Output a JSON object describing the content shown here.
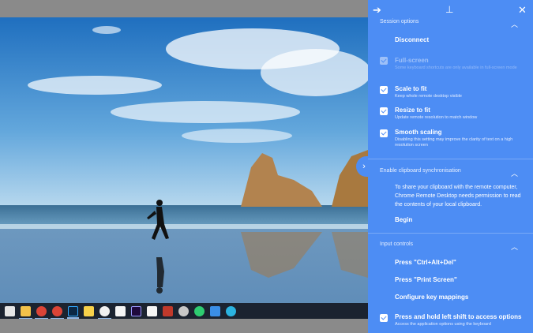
{
  "panel": {
    "top_icons": {
      "forward": "arrow-right-icon",
      "pin": "pin-icon",
      "close": "close-icon"
    },
    "sections": {
      "session": {
        "title": "Session options",
        "disconnect": "Disconnect",
        "options": [
          {
            "label": "Full-screen",
            "desc": "Some keyboard shortcuts are only available in full-screen mode",
            "checked": true,
            "disabled": true
          },
          {
            "label": "Scale to fit",
            "desc": "Keep whole remote desktop visible",
            "checked": true,
            "disabled": false
          },
          {
            "label": "Resize to fit",
            "desc": "Update remote resolution to match window",
            "checked": true,
            "disabled": false
          },
          {
            "label": "Smooth scaling",
            "desc": "Disabling this setting may improve the clarity of text on a high resolution screen",
            "checked": true,
            "disabled": false
          }
        ]
      },
      "clipboard": {
        "title": "Enable clipboard synchronisation",
        "text": "To share your clipboard with the remote computer, Chrome Remote Desktop needs permission to read the contents of your local clipboard.",
        "begin": "Begin"
      },
      "input": {
        "title": "Input controls",
        "actions": [
          "Press \"Ctrl+Alt+Del\"",
          "Press \"Print Screen\"",
          "Configure key mappings"
        ],
        "shift_option": {
          "label": "Press and hold left shift to access options",
          "desc": "Access the application options using the keyboard",
          "checked": true
        }
      }
    }
  },
  "colors": {
    "panel_bg": "#4d8df4",
    "outer_bg": "#8a8a8a",
    "taskbar": "#1b2330"
  }
}
